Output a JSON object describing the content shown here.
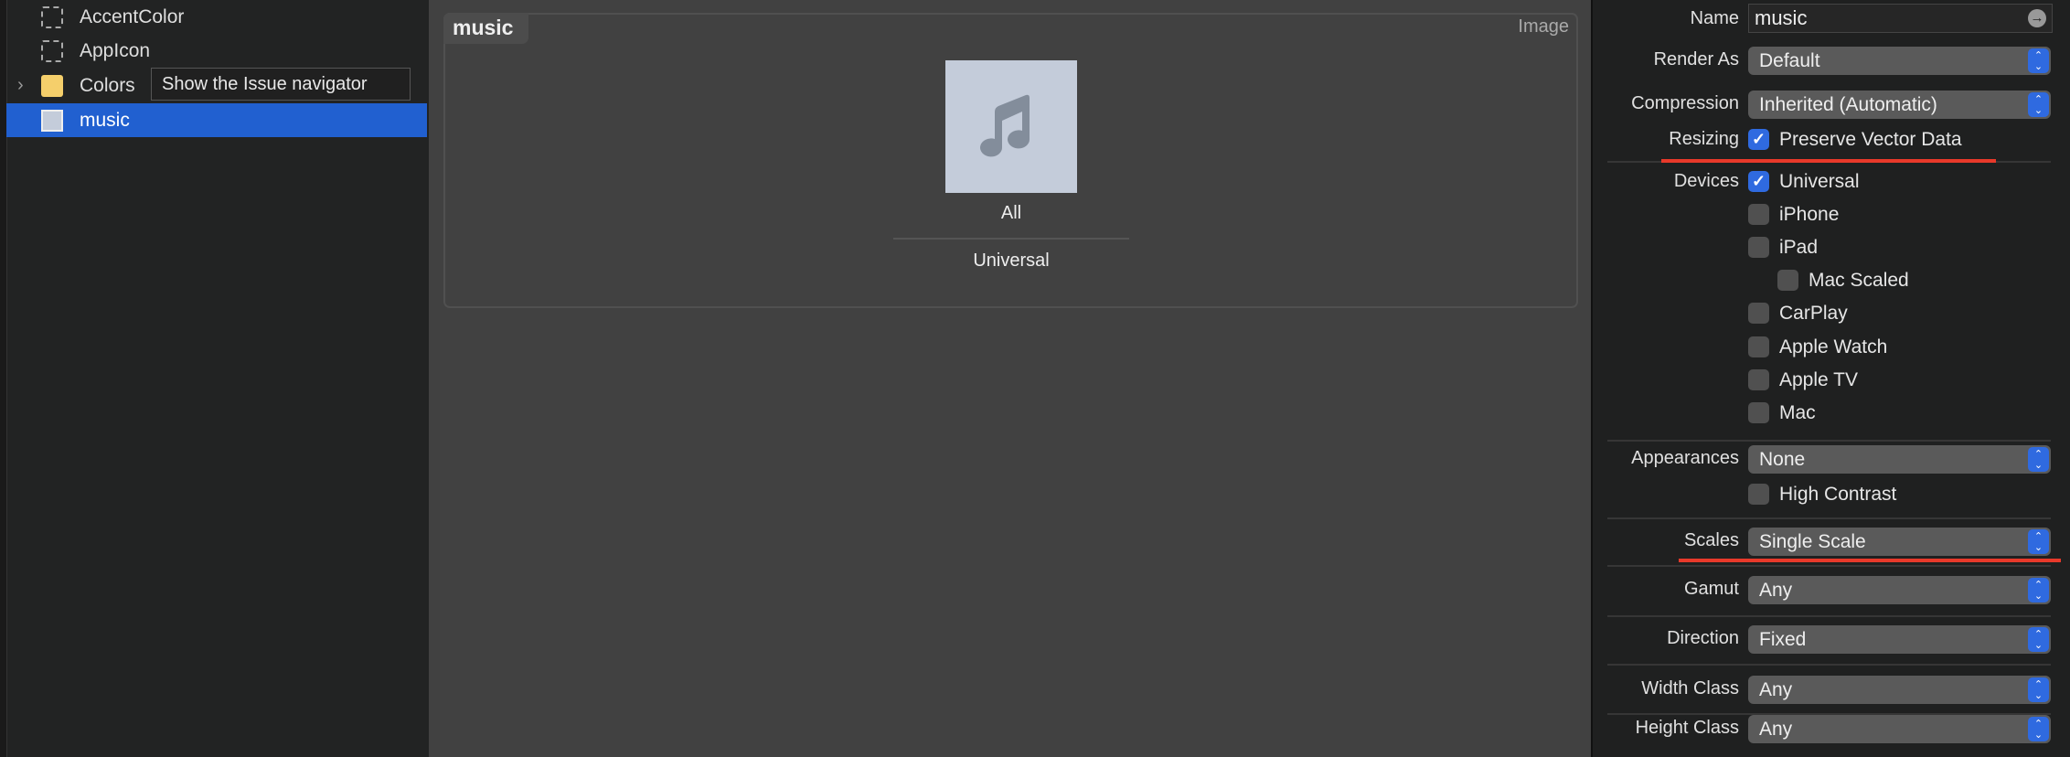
{
  "navigator": {
    "items": [
      {
        "label": "AccentColor",
        "icon": "color-set-icon"
      },
      {
        "label": "AppIcon",
        "icon": "app-icon-set-icon"
      },
      {
        "label": "Colors",
        "icon": "folder-icon",
        "expandable": true
      },
      {
        "label": "music",
        "icon": "image-set-icon",
        "selected": true
      }
    ],
    "tooltip": "Show the Issue navigator"
  },
  "editor": {
    "asset_name": "music",
    "asset_kind": "Image",
    "slot_label": "All",
    "slot_group": "Universal"
  },
  "inspector": {
    "name_label": "Name",
    "name_value": "music",
    "rows": [
      {
        "label": "Render As",
        "type": "popup",
        "value": "Default"
      },
      {
        "label": "Compression",
        "type": "popup",
        "value": "Inherited (Automatic)"
      },
      {
        "label": "Resizing",
        "type": "checkbox",
        "value": "Preserve Vector Data",
        "checked": true,
        "highlighted": true
      },
      {
        "label": "Devices",
        "type": "checkbox",
        "value": "Universal",
        "checked": true
      },
      {
        "label": "",
        "type": "checkbox",
        "value": "iPhone",
        "checked": false
      },
      {
        "label": "",
        "type": "checkbox",
        "value": "iPad",
        "checked": false
      },
      {
        "label": "",
        "type": "checkbox",
        "value": "Mac Scaled",
        "checked": false,
        "indent": true
      },
      {
        "label": "",
        "type": "checkbox",
        "value": "CarPlay",
        "checked": false
      },
      {
        "label": "",
        "type": "checkbox",
        "value": "Apple Watch",
        "checked": false
      },
      {
        "label": "",
        "type": "checkbox",
        "value": "Apple TV",
        "checked": false
      },
      {
        "label": "",
        "type": "checkbox",
        "value": "Mac",
        "checked": false
      },
      {
        "label": "Appearances",
        "type": "popup",
        "value": "None"
      },
      {
        "label": "",
        "type": "checkbox",
        "value": "High Contrast",
        "checked": false
      },
      {
        "label": "Scales",
        "type": "popup",
        "value": "Single Scale",
        "highlighted": true
      },
      {
        "label": "Gamut",
        "type": "popup",
        "value": "Any"
      },
      {
        "label": "Direction",
        "type": "popup",
        "value": "Fixed"
      },
      {
        "label": "Width Class",
        "type": "popup",
        "value": "Any"
      },
      {
        "label": "Height Class",
        "type": "popup",
        "value": "Any"
      }
    ]
  },
  "colors": {
    "selection": "#2160d0",
    "accent": "#2f6ae0",
    "annotation": "#e8392a"
  }
}
